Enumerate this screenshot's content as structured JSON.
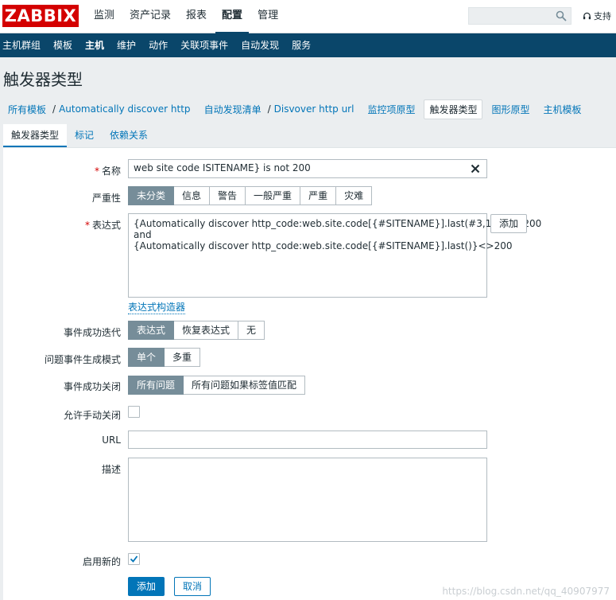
{
  "logo": "ZABBIX",
  "top_nav": [
    "监测",
    "资产记录",
    "报表",
    "配置",
    "管理"
  ],
  "support": "支持",
  "sub_nav": [
    "主机群组",
    "模板",
    "主机",
    "维护",
    "动作",
    "关联项事件",
    "自动发现",
    "服务"
  ],
  "page_title": "触发器类型",
  "breadcrumbs": [
    "所有模板",
    "Automatically discover http",
    "自动发现清单",
    "Disvover http url",
    "监控项原型",
    "触发器类型",
    "图形原型",
    "主机模板"
  ],
  "tabs": [
    "触发器类型",
    "标记",
    "依赖关系"
  ],
  "form": {
    "name_label": "名称",
    "name_value": "web site code ISITENAME} is not 200",
    "severity_label": "严重性",
    "severity_options": [
      "未分类",
      "信息",
      "警告",
      "一般严重",
      "严重",
      "灾难"
    ],
    "expression_label": "表达式",
    "expression_lines": [
      "{Automatically discover http_code:web.site.code[{#SITENAME}].last(#3,15)}<>200",
      "and",
      "{Automatically discover http_code:web.site.code[{#SITENAME}].last()}<>200"
    ],
    "add_expr_button": "添加",
    "expr_builder_link": "表达式构造器",
    "ok_event_gen_label": "事件成功迭代",
    "ok_event_gen_options": [
      "表达式",
      "恢复表达式",
      "无"
    ],
    "problem_mode_label": "问题事件生成模式",
    "problem_mode_options": [
      "单个",
      "多重"
    ],
    "ok_close_label": "事件成功关闭",
    "ok_close_options": [
      "所有问题",
      "所有问题如果标签值匹配"
    ],
    "manual_close_label": "允许手动关闭",
    "url_label": "URL",
    "url_value": "",
    "description_label": "描述",
    "description_value": "",
    "enabled_label": "启用新的",
    "submit_button": "添加",
    "cancel_button": "取消"
  },
  "watermark": "https://blog.csdn.net/qq_40907977",
  "colors": {
    "brand_red": "#d40000",
    "nav_blue": "#0a466a",
    "link_blue": "#0275b8",
    "selected_gray": "#768d99"
  }
}
